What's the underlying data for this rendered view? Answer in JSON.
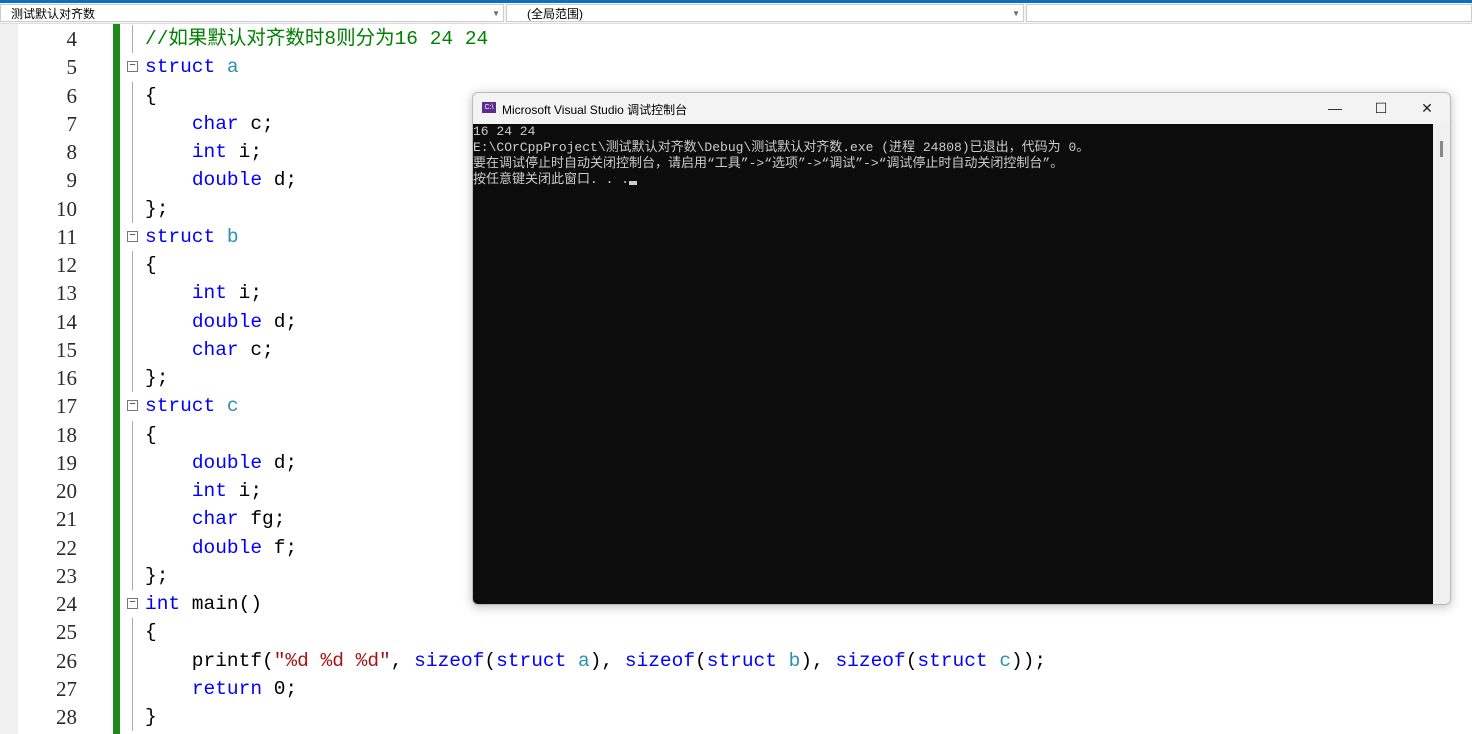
{
  "navbar": {
    "project": "测试默认对齐数",
    "scope": "(全局范围)"
  },
  "code": [
    {
      "n": "4",
      "fold": false,
      "tokens": [
        [
          "//如果默认对齐数时8则分为16 24 24",
          "cm"
        ]
      ]
    },
    {
      "n": "5",
      "fold": true,
      "tokens": [
        [
          "struct ",
          "kw"
        ],
        [
          "a",
          "ty"
        ]
      ]
    },
    {
      "n": "6",
      "fold": false,
      "tokens": [
        [
          "{",
          "pl"
        ]
      ]
    },
    {
      "n": "7",
      "fold": false,
      "tokens": [
        [
          "    ",
          "pl"
        ],
        [
          "char",
          "kw"
        ],
        [
          " c;",
          "pl"
        ]
      ]
    },
    {
      "n": "8",
      "fold": false,
      "tokens": [
        [
          "    ",
          "pl"
        ],
        [
          "int",
          "kw"
        ],
        [
          " i;",
          "pl"
        ]
      ]
    },
    {
      "n": "9",
      "fold": false,
      "tokens": [
        [
          "    ",
          "pl"
        ],
        [
          "double",
          "kw"
        ],
        [
          " d;",
          "pl"
        ]
      ]
    },
    {
      "n": "10",
      "fold": false,
      "tokens": [
        [
          "};",
          "pl"
        ]
      ]
    },
    {
      "n": "11",
      "fold": true,
      "tokens": [
        [
          "struct ",
          "kw"
        ],
        [
          "b",
          "ty"
        ]
      ]
    },
    {
      "n": "12",
      "fold": false,
      "tokens": [
        [
          "{",
          "pl"
        ]
      ]
    },
    {
      "n": "13",
      "fold": false,
      "tokens": [
        [
          "    ",
          "pl"
        ],
        [
          "int",
          "kw"
        ],
        [
          " i;",
          "pl"
        ]
      ]
    },
    {
      "n": "14",
      "fold": false,
      "tokens": [
        [
          "    ",
          "pl"
        ],
        [
          "double",
          "kw"
        ],
        [
          " d;",
          "pl"
        ]
      ]
    },
    {
      "n": "15",
      "fold": false,
      "tokens": [
        [
          "    ",
          "pl"
        ],
        [
          "char",
          "kw"
        ],
        [
          " c;",
          "pl"
        ]
      ]
    },
    {
      "n": "16",
      "fold": false,
      "tokens": [
        [
          "};",
          "pl"
        ]
      ]
    },
    {
      "n": "17",
      "fold": true,
      "tokens": [
        [
          "struct ",
          "kw"
        ],
        [
          "c",
          "ty"
        ]
      ]
    },
    {
      "n": "18",
      "fold": false,
      "tokens": [
        [
          "{",
          "pl"
        ]
      ]
    },
    {
      "n": "19",
      "fold": false,
      "tokens": [
        [
          "    ",
          "pl"
        ],
        [
          "double",
          "kw"
        ],
        [
          " d;",
          "pl"
        ]
      ]
    },
    {
      "n": "20",
      "fold": false,
      "tokens": [
        [
          "    ",
          "pl"
        ],
        [
          "int",
          "kw"
        ],
        [
          " i;",
          "pl"
        ]
      ]
    },
    {
      "n": "21",
      "fold": false,
      "tokens": [
        [
          "    ",
          "pl"
        ],
        [
          "char",
          "kw"
        ],
        [
          " fg;",
          "pl"
        ]
      ]
    },
    {
      "n": "22",
      "fold": false,
      "tokens": [
        [
          "    ",
          "pl"
        ],
        [
          "double",
          "kw"
        ],
        [
          " f;",
          "pl"
        ]
      ]
    },
    {
      "n": "23",
      "fold": false,
      "tokens": [
        [
          "};",
          "pl"
        ]
      ]
    },
    {
      "n": "24",
      "fold": true,
      "tokens": [
        [
          "int",
          "kw"
        ],
        [
          " main()",
          "pl"
        ]
      ]
    },
    {
      "n": "25",
      "fold": false,
      "tokens": [
        [
          "{",
          "pl"
        ]
      ]
    },
    {
      "n": "26",
      "fold": false,
      "tokens": [
        [
          "    printf(",
          "pl"
        ],
        [
          "\"%d %d %d\"",
          "st"
        ],
        [
          ", ",
          "pl"
        ],
        [
          "sizeof",
          "kw"
        ],
        [
          "(",
          "pl"
        ],
        [
          "struct ",
          "kw"
        ],
        [
          "a",
          "ty"
        ],
        [
          "), ",
          "pl"
        ],
        [
          "sizeof",
          "kw"
        ],
        [
          "(",
          "pl"
        ],
        [
          "struct ",
          "kw"
        ],
        [
          "b",
          "ty"
        ],
        [
          "), ",
          "pl"
        ],
        [
          "sizeof",
          "kw"
        ],
        [
          "(",
          "pl"
        ],
        [
          "struct ",
          "kw"
        ],
        [
          "c",
          "ty"
        ],
        [
          "));",
          "pl"
        ]
      ]
    },
    {
      "n": "27",
      "fold": false,
      "tokens": [
        [
          "    ",
          "pl"
        ],
        [
          "return",
          "kw"
        ],
        [
          " 0;",
          "pl"
        ]
      ]
    },
    {
      "n": "28",
      "fold": false,
      "tokens": [
        [
          "}",
          "pl"
        ]
      ]
    }
  ],
  "console": {
    "title": "Microsoft Visual Studio 调试控制台",
    "icon": "C:\\",
    "minimize": "—",
    "maximize": "☐",
    "close": "✕",
    "lines": [
      "16 24 24",
      "E:\\COrCppProject\\测试默认对齐数\\Debug\\测试默认对齐数.exe (进程 24808)已退出，代码为 0。",
      "要在调试停止时自动关闭控制台，请启用“工具”->“选项”->“调试”->“调试停止时自动关闭控制台”。",
      "按任意键关闭此窗口. . ."
    ]
  }
}
